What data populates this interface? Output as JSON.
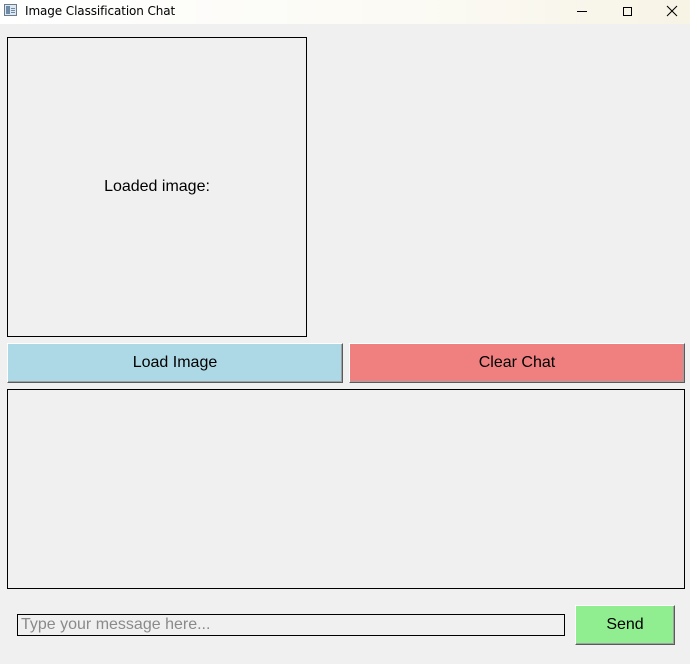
{
  "window": {
    "title": "Image Classification Chat",
    "controls": [
      "minimize",
      "maximize",
      "close"
    ]
  },
  "image_panel": {
    "label": "Loaded image:"
  },
  "buttons": {
    "load_image": "Load Image",
    "clear_chat": "Clear Chat",
    "send": "Send"
  },
  "chat": {
    "messages": []
  },
  "input": {
    "value": "",
    "placeholder": "Type your message here..."
  },
  "colors": {
    "load_button": "#add8e6",
    "clear_button": "#f08080",
    "send_button": "#90ee90",
    "background": "#f0f0f0"
  }
}
